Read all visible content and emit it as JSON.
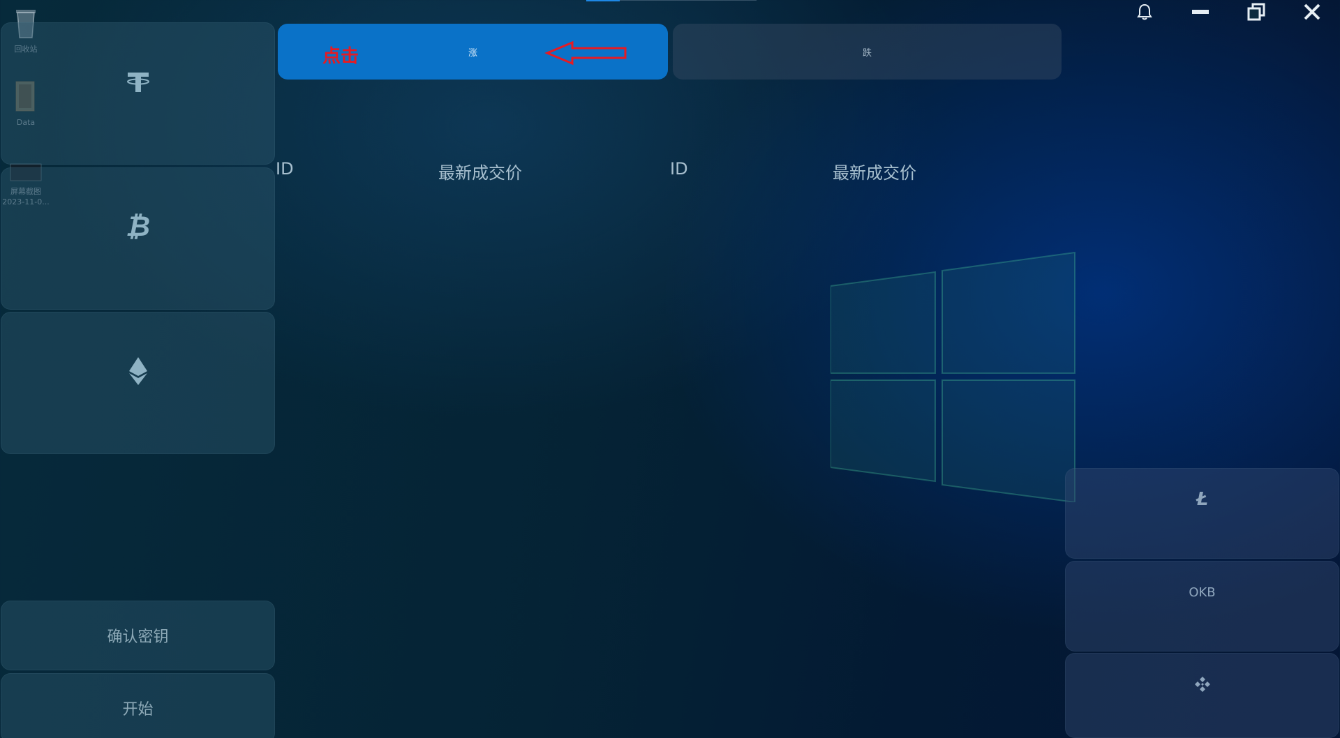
{
  "desktop": {
    "icons": [
      {
        "label": "回收站",
        "icon": "recycle-bin-icon"
      },
      {
        "label": "Data",
        "icon": "folder-icon"
      },
      {
        "label": "屏幕截图",
        "icon": "screenshot-thumbnail-icon"
      },
      {
        "label": "2023-11-0...",
        "icon": ""
      }
    ]
  },
  "left_panel": {
    "coins": [
      {
        "icon": "tether-icon"
      },
      {
        "icon": "bitcoin-icon"
      },
      {
        "icon": "ethereum-icon"
      }
    ],
    "confirm_key_label": "确认密钥",
    "start_label": "开始"
  },
  "toggles": {
    "up_label": "涨",
    "down_label": "跌",
    "active": "up"
  },
  "annotation": {
    "text": "点击",
    "color": "#e51b23"
  },
  "table": {
    "left_headers": [
      "ID",
      "最新成交价"
    ],
    "right_headers": [
      "ID",
      "最新成交价"
    ]
  },
  "window_controls": [
    "bell-icon",
    "minimize-icon",
    "restore-icon",
    "close-icon"
  ],
  "right_panel": {
    "items": [
      {
        "icon": "litecoin-icon",
        "label": ""
      },
      {
        "icon": "",
        "label": "OKB"
      },
      {
        "icon": "bnb-icon",
        "label": ""
      }
    ]
  },
  "colors": {
    "accent": "#0a72c8",
    "background": "#052335"
  }
}
